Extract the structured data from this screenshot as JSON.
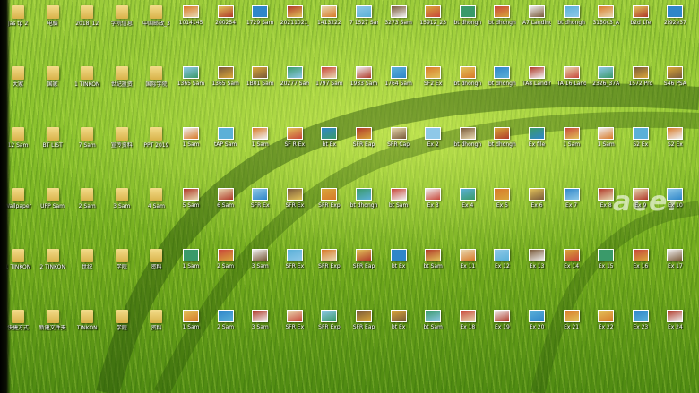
{
  "desktop": {
    "watermark": "acer",
    "labels": [
      "Jas tp 2",
      "电脑",
      "2018_12",
      "学院信息",
      "中国邮政_3",
      "1014145",
      "200254",
      "1729 Sam",
      "20211021_1",
      "1413222",
      "7 1527 Sam",
      "3273 Sam",
      "15912_23",
      "bt dhongh",
      "bt dhongh",
      "A7 Landing",
      "bt dhongh",
      "3150c3_A",
      "b2d 1fe",
      "2f92e37",
      "大家",
      "国家",
      "1 TINKON",
      "世纪投资",
      "国际学院",
      "1365 Sam",
      "1365 Sam",
      "1B01 Sam",
      "20277 Sam",
      "1797 Sam",
      "1933 Sam",
      "1764 Sam",
      "SF2 Ex",
      "bt dhongh",
      "bt dhongh",
      "TA8 Landing",
      "TA 16 Landing",
      "2326_37A",
      "1572 Pro",
      "S46 PSA",
      "12 Sam",
      "BT LIST",
      "7 Sam",
      "宣传资料",
      "PPT 2019",
      "1 Sam",
      "tAP Sam",
      "1 Sam",
      "SF R Ex",
      "bt Ex",
      "SFR Eap",
      "SFR Cap",
      "Ex 2",
      "bt dhongh",
      "bt dhongh",
      "Ex file",
      "1 Sam",
      "1 Sam",
      "S2 Ex",
      "S2 Ex",
      "Wallpaper",
      "UPP Sam",
      "2 Sam",
      "3 Sam",
      "4 Sam",
      "5 Sam",
      "6 Sam",
      "SFR Ex",
      "SFR Ex",
      "SFR Exp",
      "bt dhongh",
      "bt Sam",
      "Ex 3",
      "Ex 4",
      "Ex 5",
      "Ex 6",
      "Ex 7",
      "Ex 8",
      "Ex 9",
      "Ex 10",
      "1 TINKON",
      "2 TINKON",
      "世纪",
      "学院",
      "资料",
      "1 Sam",
      "2 Sam",
      "3 Sam",
      "SFR Ex",
      "SFR Exp",
      "SFR Eap",
      "bt Ex",
      "bt Sam",
      "Ex 11",
      "Ex 12",
      "Ex 13",
      "Ex 14",
      "Ex 15",
      "Ex 16",
      "Ex 17",
      "快捷方式",
      "新建文件夹",
      "TINKON",
      "学院",
      "资料",
      "1 Sam",
      "2 Sam",
      "3 Sam",
      "SFR Ex",
      "SFR Exp",
      "SFR Eap",
      "bt Ex",
      "bt Sam",
      "Ex 18",
      "Ex 19",
      "Ex 20",
      "Ex 21",
      "Ex 22",
      "Ex 23",
      "Ex 24"
    ]
  }
}
